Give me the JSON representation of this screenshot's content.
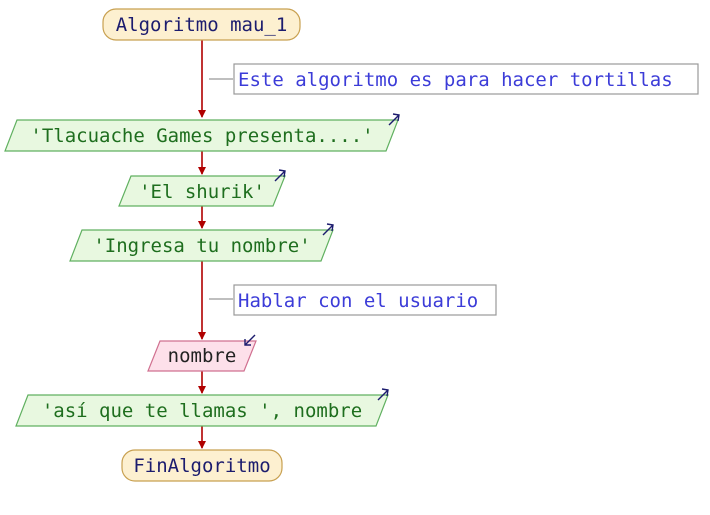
{
  "diagram": {
    "start": {
      "label": "Algoritmo mau_1"
    },
    "comment_1": {
      "label": "Este algoritmo es para hacer tortillas"
    },
    "output_1": {
      "label": "'Tlacuache Games presenta....'"
    },
    "output_2": {
      "label": "'El shurik'"
    },
    "output_3": {
      "label": "'Ingresa tu nombre'"
    },
    "comment_2": {
      "label": "Hablar con el usuario"
    },
    "input_1": {
      "label": "nombre"
    },
    "output_4": {
      "label": "'así que te llamas ', nombre"
    },
    "end": {
      "label": "FinAlgoritmo"
    }
  },
  "colors": {
    "flow_line": "#b00000",
    "terminal_fill": "#fdf0d0",
    "terminal_stroke": "#c8a050",
    "terminal_text": "#1c1c6e",
    "output_fill": "#e8f8e0",
    "output_stroke": "#60b060",
    "output_text": "#1e6e1e",
    "input_fill": "#fde0ea",
    "input_stroke": "#d07090",
    "input_text": "#222222",
    "comment_stroke": "#999999",
    "comment_text": "#3c3cd8",
    "io_arrow": "#1c1c6e"
  }
}
